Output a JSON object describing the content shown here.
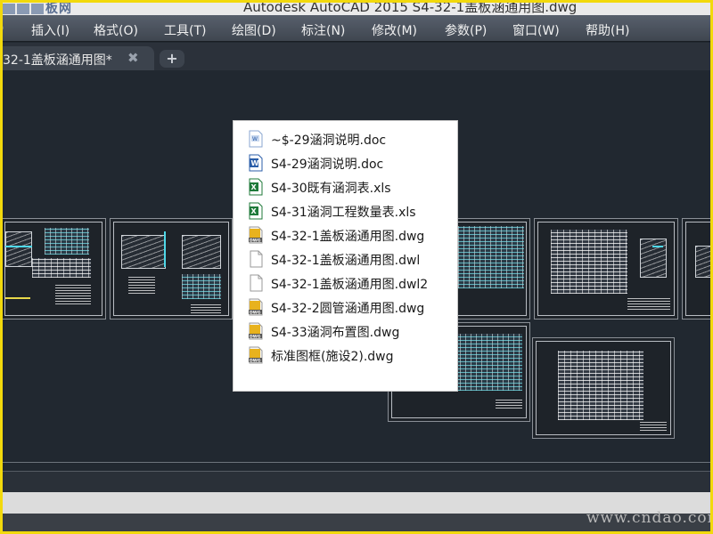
{
  "window": {
    "title": "Autodesk AutoCAD 2015    S4-32-1盖板涵通用图.dwg",
    "site_logo": "板网"
  },
  "menu": {
    "items": [
      {
        "label": ")"
      },
      {
        "label": "插入(I)"
      },
      {
        "label": "格式(O)"
      },
      {
        "label": "工具(T)"
      },
      {
        "label": "绘图(D)"
      },
      {
        "label": "标注(N)"
      },
      {
        "label": "修改(M)"
      },
      {
        "label": "参数(P)"
      },
      {
        "label": "窗口(W)"
      },
      {
        "label": "帮助(H)"
      }
    ]
  },
  "tabs": {
    "active_label": "32-1盖板涵通用图*",
    "close_glyph": "✖",
    "add_glyph": "+"
  },
  "file_list": {
    "items": [
      {
        "name": "~$-29涵洞说明.doc",
        "icon": "word-temp-icon"
      },
      {
        "name": "S4-29涵洞说明.doc",
        "icon": "word-doc-icon"
      },
      {
        "name": "S4-30既有涵洞表.xls",
        "icon": "excel-xls-icon"
      },
      {
        "name": "S4-31涵洞工程数量表.xls",
        "icon": "excel-xls-icon"
      },
      {
        "name": "S4-32-1盖板涵通用图.dwg",
        "icon": "dwg-file-icon"
      },
      {
        "name": "S4-32-1盖板涵通用图.dwl",
        "icon": "blank-file-icon"
      },
      {
        "name": "S4-32-1盖板涵通用图.dwl2",
        "icon": "blank-file-icon"
      },
      {
        "name": "S4-32-2圆管涵通用图.dwg",
        "icon": "dwg-file-icon"
      },
      {
        "name": "S4-33涵洞布置图.dwg",
        "icon": "dwg-file-icon"
      },
      {
        "name": "标准图框(施设2).dwg",
        "icon": "dwg-file-icon"
      }
    ]
  },
  "watermark": "www.cndao.com",
  "colors": {
    "border": "#f2d90c",
    "canvas": "#212830",
    "menubar": "#4b525d",
    "dwg_icon": "#e8b21e",
    "excel_icon": "#1f7a3a",
    "word_icon": "#2b5ea8"
  }
}
